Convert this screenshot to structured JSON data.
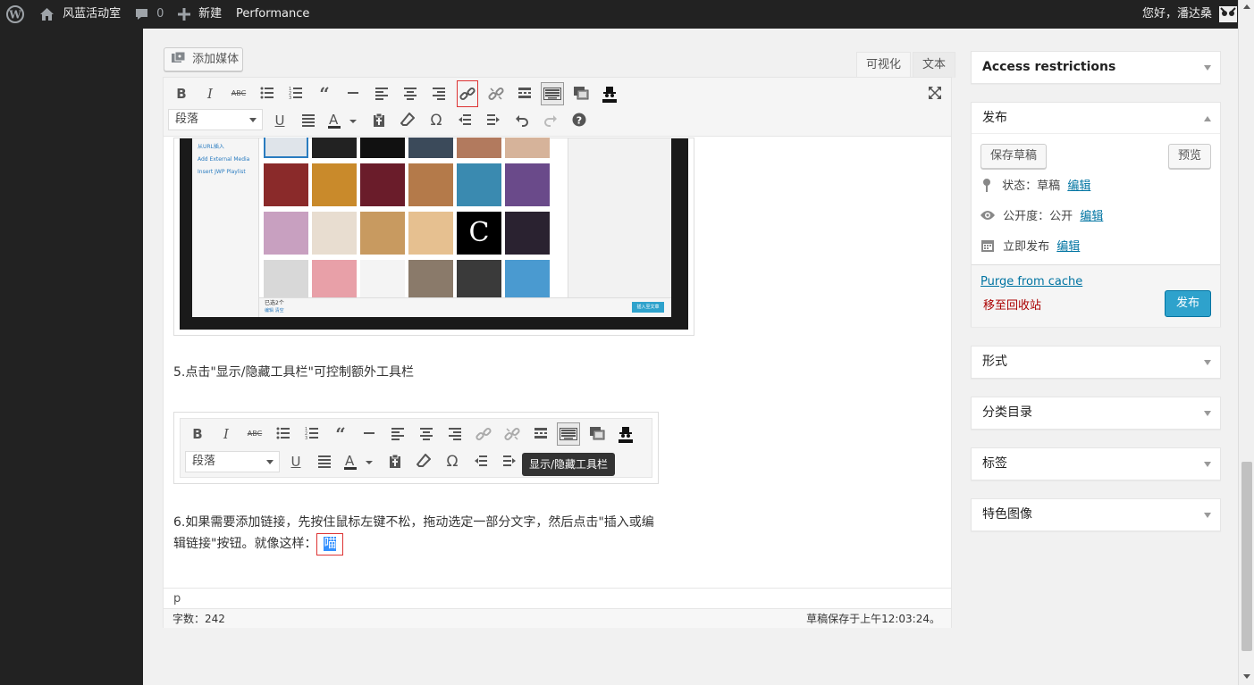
{
  "adminbar": {
    "site_name": "风蓝活动室",
    "comments_count": "0",
    "new_label": "新建",
    "performance_label": "Performance",
    "greeting": "您好，潘达桑"
  },
  "editor": {
    "add_media_label": "添加媒体",
    "tab_visual": "可视化",
    "tab_text": "文本",
    "format_select": "段落",
    "para5": "5.点击\"显示/隐藏工具栏\"可控制额外工具栏",
    "para6_line1": "6.如果需要添加链接，先按住鼠标左键不松，拖动选定一部分文字，然后点击\"插入或编",
    "para6_line2_prefix": "辑链接\"按钮。就像这样：",
    "para6_selected": "喵",
    "tooltip": "显示/隐藏工具栏",
    "path": "p",
    "word_count": "字数：242",
    "draft_saved": "草稿保存于上午12:03:24。",
    "inner_shot": {
      "left_links": [
        "从URL插入",
        "Add External Media",
        "Insert JWP Playlist"
      ],
      "selected_count": "已选2个",
      "edit_clear": "编辑  清空",
      "insert_button": "插入至文章"
    }
  },
  "sidebar": {
    "access_restrictions": "Access restrictions",
    "publish": {
      "title": "发布",
      "save_draft": "保存草稿",
      "preview": "预览",
      "status_label": "状态：",
      "status_value": "草稿",
      "visibility_label": "公开度：",
      "visibility_value": "公开",
      "schedule_label": "立即发布",
      "edit": "编辑",
      "purge": "Purge from cache",
      "trash": "移至回收站",
      "publish_button": "发布"
    },
    "format_box": "形式",
    "category_box": "分类目录",
    "tags_box": "标签",
    "featured_image_box": "特色图像"
  },
  "colors": {
    "adminbar": "#222222",
    "primary_button": "#2ea2cc",
    "link": "#0074a2",
    "trash": "#a00000",
    "highlight_border": "#dd3333"
  }
}
